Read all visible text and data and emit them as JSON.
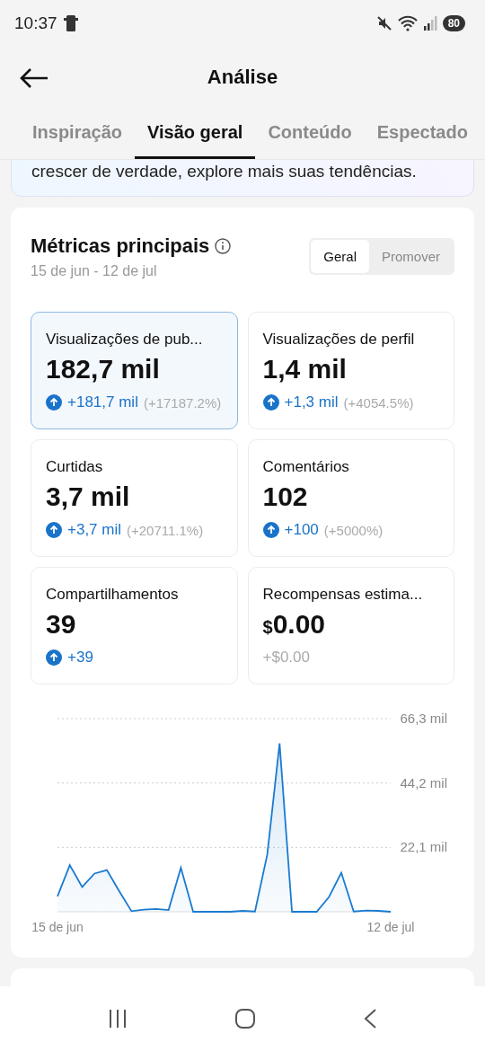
{
  "status_bar": {
    "time": "10:37",
    "battery": "80"
  },
  "header": {
    "title": "Análise"
  },
  "tabs": [
    {
      "label": "Inspiração",
      "selected": false
    },
    {
      "label": "Visão geral",
      "selected": true
    },
    {
      "label": "Conteúdo",
      "selected": false
    },
    {
      "label": "Espectado",
      "selected": false
    }
  ],
  "banner": {
    "text": "crescer de verdade, explore mais suas tendências."
  },
  "metrics_card": {
    "title": "Métricas principais",
    "date_range": "15 de jun - 12 de jul",
    "toggle": [
      {
        "label": "Geral",
        "selected": true
      },
      {
        "label": "Promover",
        "selected": false
      }
    ],
    "metrics": [
      {
        "label": "Visualizações de pub...",
        "value": "182,7 mil",
        "kind": "up",
        "delta": "+181,7 mil",
        "percent": "(+17187.2%)",
        "selected": true
      },
      {
        "label": "Visualizações de perfil",
        "value": "1,4 mil",
        "kind": "up",
        "delta": "+1,3 mil",
        "percent": "(+4054.5%)",
        "selected": false
      },
      {
        "label": "Curtidas",
        "value": "3,7 mil",
        "kind": "up",
        "delta": "+3,7 mil",
        "percent": "(+20711.1%)",
        "selected": false
      },
      {
        "label": "Comentários",
        "value": "102",
        "kind": "up",
        "delta": "+100",
        "percent": "(+5000%)",
        "selected": false
      },
      {
        "label": "Compartilhamentos",
        "value": "39",
        "kind": "up",
        "delta": "+39",
        "selected": false
      },
      {
        "label": "Recompensas estima...",
        "currency": "$",
        "value": "0.00",
        "kind": "neutral",
        "delta": "+$0.00",
        "selected": false
      }
    ],
    "chart_data": {
      "type": "area",
      "ylim": [
        0,
        66.3
      ],
      "yticks": [
        {
          "value": 22.1,
          "label": "22,1 mil"
        },
        {
          "value": 44.2,
          "label": "44,2 mil"
        },
        {
          "value": 66.3,
          "label": "66,3 mil"
        }
      ],
      "categories": [
        "15 de jun",
        null,
        null,
        null,
        null,
        null,
        null,
        null,
        null,
        null,
        null,
        null,
        null,
        null,
        null,
        null,
        null,
        null,
        null,
        null,
        null,
        null,
        null,
        null,
        null,
        null,
        null,
        "12 de jul"
      ],
      "series": [
        {
          "color": "#1a7bd1",
          "values": [
            5.3,
            16.0,
            8.5,
            13.1,
            14.3,
            7.1,
            0.2,
            0.7,
            1.0,
            0.6,
            15.1,
            0,
            0,
            0,
            0,
            0.3,
            0.1,
            19.7,
            57.8,
            0,
            0,
            0,
            5.1,
            13.4,
            0.1,
            0.4,
            0.3,
            0
          ]
        }
      ]
    }
  }
}
